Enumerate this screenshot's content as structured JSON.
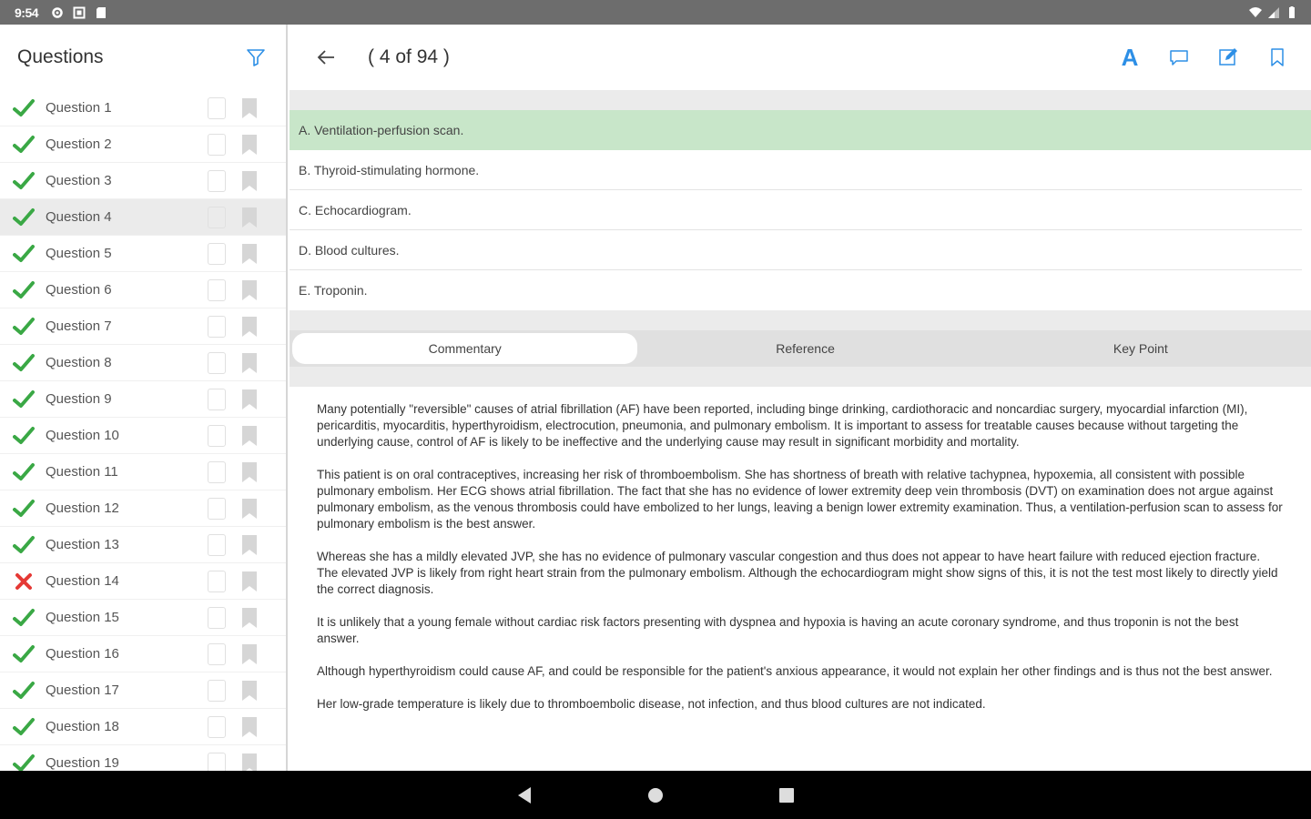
{
  "status_bar": {
    "time": "9:54",
    "icons_left": [
      "settings-icon",
      "square-icon",
      "sd-card-icon"
    ],
    "icons_right": [
      "wifi-icon",
      "signal-icon",
      "battery-icon"
    ]
  },
  "sidebar": {
    "title": "Questions",
    "questions": [
      {
        "label": "Question 1",
        "status": "correct"
      },
      {
        "label": "Question 2",
        "status": "correct"
      },
      {
        "label": "Question 3",
        "status": "correct"
      },
      {
        "label": "Question 4",
        "status": "correct",
        "active": true
      },
      {
        "label": "Question 5",
        "status": "correct"
      },
      {
        "label": "Question 6",
        "status": "correct"
      },
      {
        "label": "Question 7",
        "status": "correct"
      },
      {
        "label": "Question 8",
        "status": "correct"
      },
      {
        "label": "Question 9",
        "status": "correct"
      },
      {
        "label": "Question 10",
        "status": "correct"
      },
      {
        "label": "Question 11",
        "status": "correct"
      },
      {
        "label": "Question 12",
        "status": "correct"
      },
      {
        "label": "Question 13",
        "status": "correct"
      },
      {
        "label": "Question 14",
        "status": "incorrect"
      },
      {
        "label": "Question 15",
        "status": "correct"
      },
      {
        "label": "Question 16",
        "status": "correct"
      },
      {
        "label": "Question 17",
        "status": "correct"
      },
      {
        "label": "Question 18",
        "status": "correct"
      },
      {
        "label": "Question 19",
        "status": "correct"
      }
    ]
  },
  "header": {
    "counter": "( 4 of 94 )",
    "font_button": "A"
  },
  "answers": [
    {
      "text": "A. Ventilation-perfusion scan.",
      "correct": true
    },
    {
      "text": "B. Thyroid-stimulating hormone.",
      "correct": false
    },
    {
      "text": "C. Echocardiogram.",
      "correct": false
    },
    {
      "text": "D. Blood cultures.",
      "correct": false
    },
    {
      "text": "E. Troponin.",
      "correct": false
    }
  ],
  "tabs": [
    {
      "label": "Commentary",
      "selected": true
    },
    {
      "label": "Reference",
      "selected": false
    },
    {
      "label": "Key Point",
      "selected": false
    }
  ],
  "commentary": [
    "Many potentially \"reversible\" causes of atrial fibrillation (AF) have been reported, including binge drinking, cardiothoracic and noncardiac surgery, myocardial infarction (MI), pericarditis, myocarditis, hyperthyroidism, electrocution, pneumonia, and pulmonary embolism. It is important to assess for treatable causes because without targeting the underlying cause, control of AF is likely to be ineffective and the underlying cause may result in significant morbidity and mortality.",
    "This patient is on oral contraceptives, increasing her risk of thromboembolism. She has shortness of breath with relative tachypnea, hypoxemia, all consistent with possible pulmonary embolism. Her ECG shows atrial fibrillation. The fact that she has no evidence of lower extremity deep vein thrombosis (DVT) on examination does not argue against pulmonary embolism, as the venous thrombosis could have embolized to her lungs, leaving a benign lower extremity examination. Thus, a ventilation-perfusion scan to assess for pulmonary embolism is the best answer.",
    "Whereas she has a mildly elevated JVP, she has no evidence of pulmonary vascular congestion and thus does not appear to have heart failure with reduced ejection fracture. The elevated JVP is likely from right heart strain from the pulmonary embolism. Although the echocardiogram might show signs of this, it is not the test most likely to directly yield the correct diagnosis.",
    "It is unlikely that a young female without cardiac risk factors presenting with dyspnea and hypoxia is having an acute coronary syndrome, and thus troponin is not the best answer.",
    "Although hyperthyroidism could cause AF, and could be responsible for the patient's anxious appearance, it would not explain her other findings and is thus not the best answer.",
    "Her low-grade temperature is likely due to thromboembolic disease, not infection, and thus blood cultures are not indicated."
  ],
  "colors": {
    "accent": "#2d8fe6",
    "correct_green": "#3aa845",
    "incorrect_red": "#e53935",
    "correct_answer_bg": "#c8e6c9"
  }
}
